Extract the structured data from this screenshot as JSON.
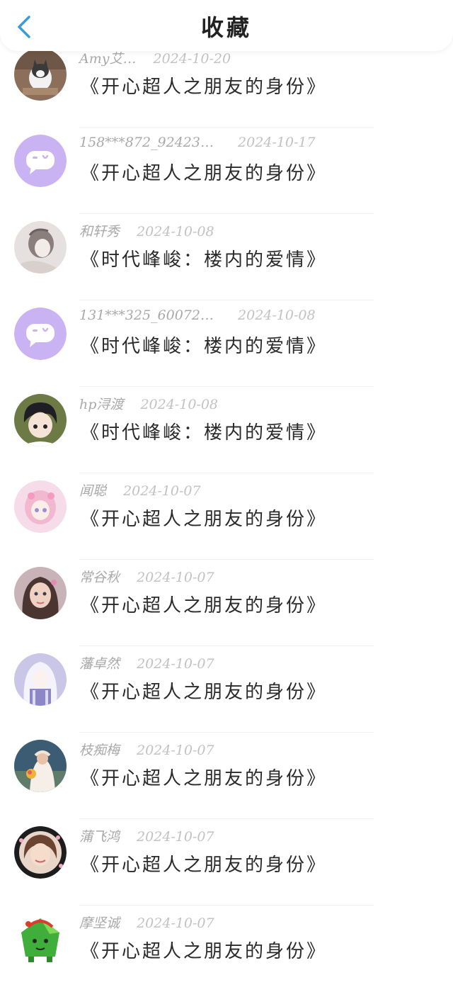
{
  "header": {
    "title": "收藏",
    "back_icon": "chevron-left-icon",
    "accent": "#3a9bdc"
  },
  "items": [
    {
      "name": "Amy艾…",
      "date": "2024-10-20",
      "title": "《开心超人之朋友的身份》",
      "avatar": "cat-photo"
    },
    {
      "name": "158***872_92423…",
      "date": "2024-10-17",
      "title": "《开心超人之朋友的身份》",
      "avatar": "default-chat-avatar"
    },
    {
      "name": "和轩秀",
      "date": "2024-10-08",
      "title": "《时代峰峻：楼内的爱情》",
      "avatar": "anime-girl-gray"
    },
    {
      "name": "131***325_60072…",
      "date": "2024-10-08",
      "title": "《时代峰峻：楼内的爱情》",
      "avatar": "default-chat-avatar"
    },
    {
      "name": "hp浔渡",
      "date": "2024-10-08",
      "title": "《时代峰峻：楼内的爱情》",
      "avatar": "anime-boy"
    },
    {
      "name": "闻聪",
      "date": "2024-10-07",
      "title": "《开心超人之朋友的身份》",
      "avatar": "anime-girl-pink"
    },
    {
      "name": "常谷秋",
      "date": "2024-10-07",
      "title": "《开心超人之朋友的身份》",
      "avatar": "girl-photo"
    },
    {
      "name": "藩卓然",
      "date": "2024-10-07",
      "title": "《开心超人之朋友的身份》",
      "avatar": "anime-girl-white"
    },
    {
      "name": "枝痴梅",
      "date": "2024-10-07",
      "title": "《开心超人之朋友的身份》",
      "avatar": "bride-photo"
    },
    {
      "name": "蒲飞鸿",
      "date": "2024-10-07",
      "title": "《开心超人之朋友的身份》",
      "avatar": "woman-photo-frame"
    },
    {
      "name": "摩坚诚",
      "date": "2024-10-07",
      "title": "《开心超人之朋友的身份》",
      "avatar": "green-cartoon"
    }
  ],
  "colors": {
    "default_avatar_bg": "#c9b3f2",
    "meta_text": "#b5b5b5",
    "title_text": "#2a2a2a"
  }
}
